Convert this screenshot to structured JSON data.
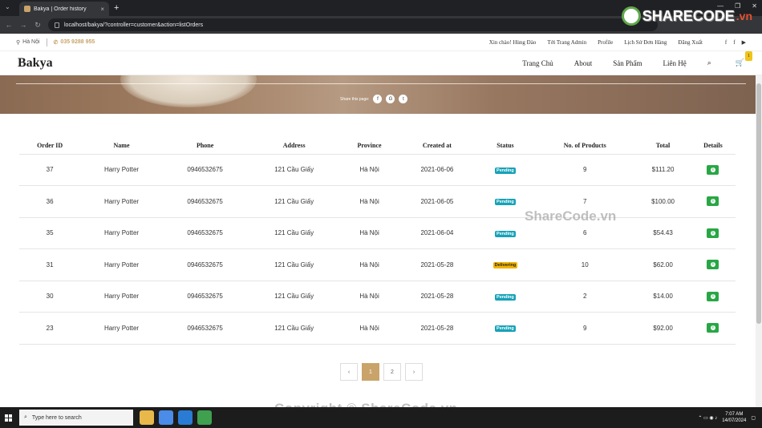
{
  "browser": {
    "tab_title": "Bakya | Order history",
    "tab_close": "×",
    "new_tab": "+",
    "url": "localhost/bakya/?controller=customer&action=listOrders"
  },
  "topbar": {
    "location": "Hà Nội",
    "phone": "035 9288 955",
    "greeting": "Xin chào! Hùng Đào",
    "links": [
      "Tới Trang Admin",
      "Profile",
      "Lịch Sử Đơn Hàng",
      "Đăng Xuất"
    ]
  },
  "nav": {
    "logo": "Bakya",
    "menu": [
      "Trang Chủ",
      "About",
      "Sản Phẩm",
      "Liên Hệ"
    ],
    "cart_count": "1"
  },
  "banner": {
    "share_label": "Share this page:"
  },
  "orders": {
    "headers": [
      "Order ID",
      "Name",
      "Phone",
      "Address",
      "Province",
      "Created at",
      "Status",
      "No. of Products",
      "Total",
      "Details"
    ],
    "rows": [
      {
        "id": "37",
        "name": "Harry Potter",
        "phone": "0946532675",
        "address": "121 Cầu Giấy",
        "province": "Hà Nội",
        "created": "2021-06-06",
        "status": "Pending",
        "count": "9",
        "total": "$111.20"
      },
      {
        "id": "36",
        "name": "Harry Potter",
        "phone": "0946532675",
        "address": "121 Cầu Giấy",
        "province": "Hà Nội",
        "created": "2021-06-05",
        "status": "Pending",
        "count": "7",
        "total": "$100.00"
      },
      {
        "id": "35",
        "name": "Harry Potter",
        "phone": "0946532675",
        "address": "121 Cầu Giấy",
        "province": "Hà Nội",
        "created": "2021-06-04",
        "status": "Pending",
        "count": "6",
        "total": "$54.43"
      },
      {
        "id": "31",
        "name": "Harry Potter",
        "phone": "0946532675",
        "address": "121 Cầu Giấy",
        "province": "Hà Nội",
        "created": "2021-05-28",
        "status": "Delivering",
        "count": "10",
        "total": "$62.00"
      },
      {
        "id": "30",
        "name": "Harry Potter",
        "phone": "0946532675",
        "address": "121 Cầu Giấy",
        "province": "Hà Nội",
        "created": "2021-05-28",
        "status": "Pending",
        "count": "2",
        "total": "$14.00"
      },
      {
        "id": "23",
        "name": "Harry Potter",
        "phone": "0946532675",
        "address": "121 Cầu Giấy",
        "province": "Hà Nội",
        "created": "2021-05-28",
        "status": "Pending",
        "count": "9",
        "total": "$92.00"
      }
    ],
    "status_colors": {
      "Pending": "#17a2b8",
      "Delivering": "#f0b400"
    }
  },
  "pagination": {
    "prev": "‹",
    "pages": [
      "1",
      "2"
    ],
    "next": "›",
    "active": "1"
  },
  "watermarks": {
    "mid": "ShareCode.vn",
    "bottom": "Copyright © ShareCode.vn",
    "logo": "SHARECODE",
    "logo_suffix": ".vn"
  },
  "taskbar": {
    "search_placeholder": "Type here to search",
    "time": "7:07 AM",
    "date": "14/07/2024"
  },
  "accent_color": "#c9a36a"
}
